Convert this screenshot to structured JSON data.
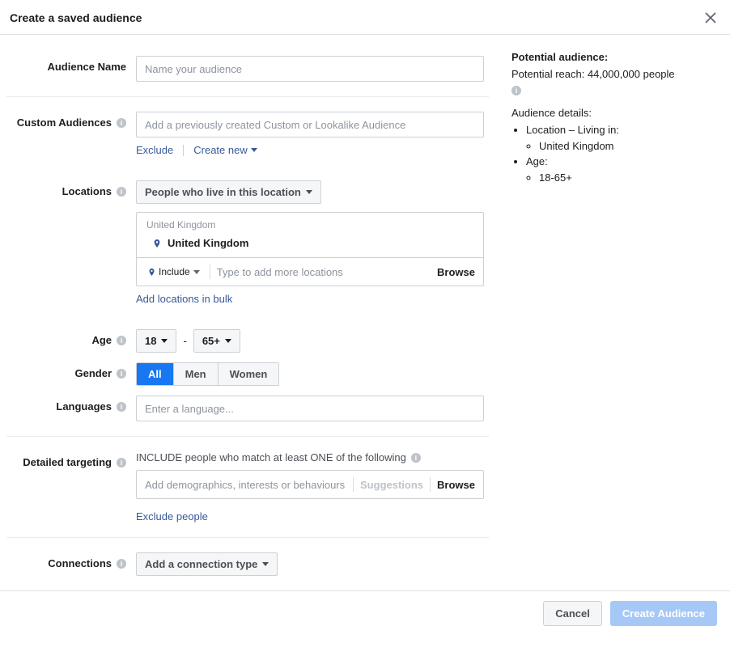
{
  "header": {
    "title": "Create a saved audience"
  },
  "labels": {
    "audience_name": "Audience Name",
    "custom_audiences": "Custom Audiences",
    "locations": "Locations",
    "age": "Age",
    "gender": "Gender",
    "languages": "Languages",
    "detailed_targeting": "Detailed targeting",
    "connections": "Connections"
  },
  "audience_name": {
    "placeholder": "Name your audience"
  },
  "custom_audiences": {
    "placeholder": "Add a previously created Custom or Lookalike Audience",
    "exclude": "Exclude",
    "create_new": "Create new"
  },
  "locations": {
    "dropdown": "People who live in this location",
    "group_label": "United Kingdom",
    "selected": "United Kingdom",
    "include": "Include",
    "input_placeholder": "Type to add more locations",
    "browse": "Browse",
    "bulk": "Add locations in bulk"
  },
  "age": {
    "min": "18",
    "max": "65+"
  },
  "gender": {
    "all": "All",
    "men": "Men",
    "women": "Women"
  },
  "languages": {
    "placeholder": "Enter a language..."
  },
  "targeting": {
    "heading": "INCLUDE people who match at least ONE of the following",
    "placeholder": "Add demographics, interests or behaviours",
    "suggestions": "Suggestions",
    "browse": "Browse",
    "exclude": "Exclude people"
  },
  "connections": {
    "dropdown": "Add a connection type"
  },
  "sidebar": {
    "heading": "Potential audience:",
    "reach": "Potential reach: 44,000,000 people",
    "details_heading": "Audience details:",
    "location_label": "Location – Living in:",
    "location_value": "United Kingdom",
    "age_label": "Age:",
    "age_value": "18-65+"
  },
  "footer": {
    "cancel": "Cancel",
    "create": "Create Audience"
  }
}
